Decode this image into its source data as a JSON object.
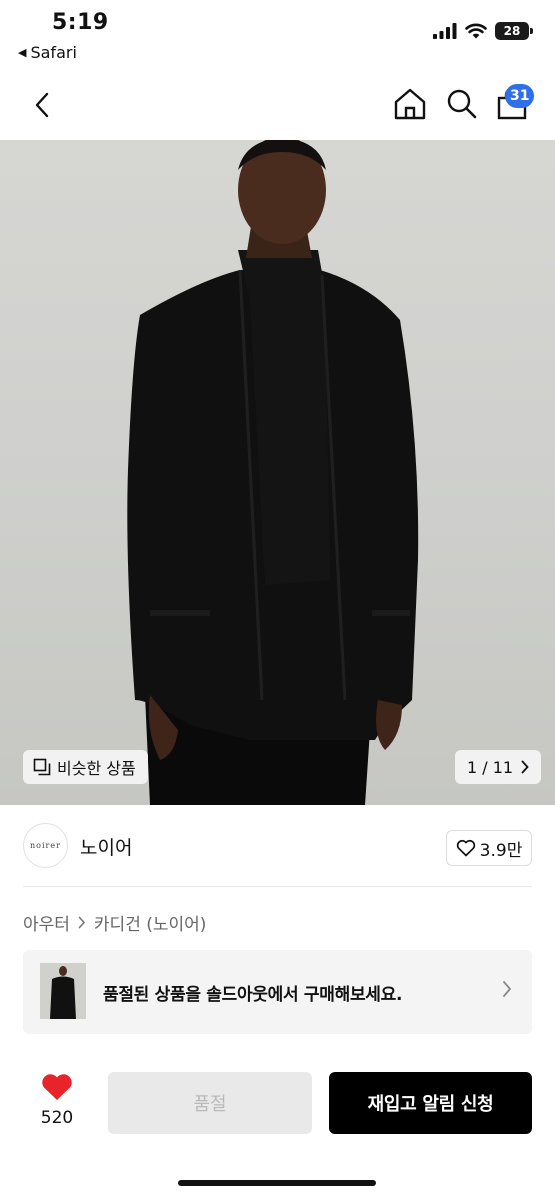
{
  "status_bar": {
    "time": "5:19",
    "back_app": "Safari",
    "battery": "28"
  },
  "nav": {
    "cart_count": "31",
    "icons": [
      "chevron-left-icon",
      "home-icon",
      "search-icon",
      "bag-icon"
    ],
    "badge_color": "#2f6fe8"
  },
  "hero": {
    "similar_label": "비슷한 상품",
    "counter": "1 / 11"
  },
  "brand": {
    "logo_text": "noirer",
    "name": "노이어",
    "like_count": "3.9만"
  },
  "breadcrumb": {
    "items": [
      "아우터",
      "카디건 (노이어)"
    ]
  },
  "soldout_banner": {
    "text": "품절된 상품을 솔드아웃에서 구매해보세요."
  },
  "action_bar": {
    "like_count": "520",
    "like_color": "#e8232a",
    "soldout_label": "품절",
    "restock_label": "재입고 알림 신청"
  }
}
